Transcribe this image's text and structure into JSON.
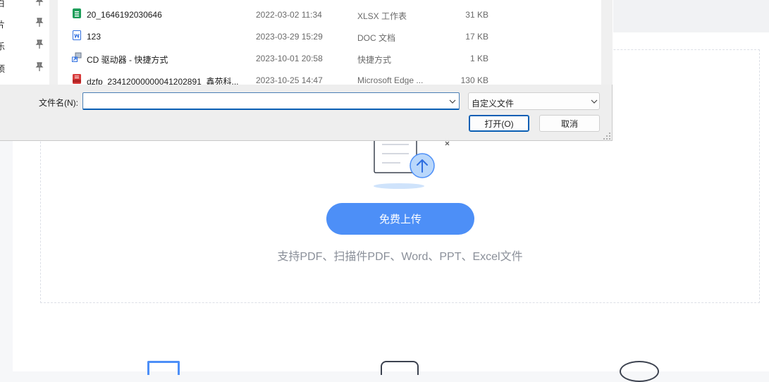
{
  "dialog": {
    "nav_items": [
      {
        "label": "白",
        "icon": "pin-icon"
      },
      {
        "label": "片",
        "icon": "pin-icon"
      },
      {
        "label": "乐",
        "icon": "pin-icon"
      },
      {
        "label": "项",
        "icon": "pin-icon"
      }
    ],
    "files": [
      {
        "name": "20_1646192030646",
        "date": "2022-03-02 11:34",
        "type": "XLSX 工作表",
        "size": "31 KB",
        "icon": "xlsx-file-icon"
      },
      {
        "name": "123",
        "date": "2023-03-29 15:29",
        "type": "DOC 文档",
        "size": "17 KB",
        "icon": "doc-file-icon"
      },
      {
        "name": "CD 驱动器 - 快捷方式",
        "date": "2023-10-01 20:58",
        "type": "快捷方式",
        "size": "1 KB",
        "icon": "shortcut-icon"
      },
      {
        "name": "dzfp_23412000000041202891_鑫苑科...",
        "date": "2023-10-25 14:47",
        "type": "Microsoft Edge ...",
        "size": "130 KB",
        "icon": "pdf-file-icon"
      }
    ],
    "filename_label": "文件名(N):",
    "filename_value": "",
    "file_type": "自定义文件",
    "open_label": "打开(O)",
    "cancel_label": "取消"
  },
  "upload": {
    "button_label": "免费上传",
    "support_text": "支持PDF、扫描件PDF、Word、PPT、Excel文件"
  },
  "colors": {
    "accent": "#4d8ff7",
    "dialog_bg": "#eeeeee",
    "focus": "#0a5fb4"
  }
}
